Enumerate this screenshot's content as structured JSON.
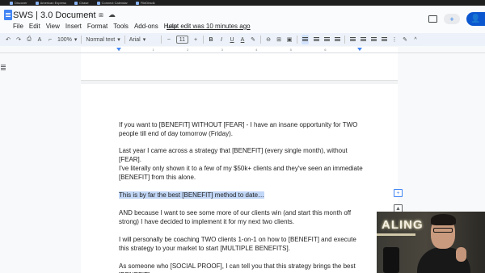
{
  "bookmarks": [
    {
      "label": "Discover"
    },
    {
      "label": "American Express"
    },
    {
      "label": "Chase"
    },
    {
      "label": "Connect Calendar"
    },
    {
      "label": "FileDirsdk"
    }
  ],
  "header": {
    "title": "SWS | 3.0 Document",
    "star_icon": "☆",
    "folder_icon": "⧈",
    "cloud_icon": "☁",
    "menu": [
      "File",
      "Edit",
      "View",
      "Insert",
      "Format",
      "Tools",
      "Add-ons",
      "Help"
    ],
    "last_edit": "Last edit was 10 minutes ago",
    "meet_icon": "+",
    "share_icon": "👤"
  },
  "toolbar": {
    "undo": "↶",
    "redo": "↷",
    "print": "⎙",
    "spell": "A",
    "paint": "⌐",
    "zoom": "100%",
    "style": "Normal text",
    "font": "Arial",
    "minus": "−",
    "size": "11",
    "plus": "+",
    "bold": "B",
    "italic": "I",
    "underline": "U",
    "text_color": "A",
    "highlight": "✎",
    "link": "⊖",
    "comment": "⊞",
    "image": "▣",
    "dropdown_arrow": "▾",
    "more": "⋮",
    "edit_pencil": "✎",
    "collapse": "^"
  },
  "ruler": {
    "numbers": [
      "1",
      "1",
      "2",
      "3",
      "4",
      "5",
      "6",
      "7"
    ]
  },
  "document": {
    "paragraphs": [
      "If you want to [BENEFIT] WITHOUT [FEAR] - I have an insane opportunity for TWO people till end of day tomorrow (Friday).",
      "Last year I came across a strategy that [BENEFIT] (every single month), without [FEAR].",
      "I've literally only shown it to a few of my $50k+ clients and they've seen an immediate [BENEFIT] from this alone.",
      "This is by far the best [BENEFIT] method to date…",
      "AND because I want to see some more of our clients win (and start this month off strong) I have decided to implement it for my next two clients.",
      "I will personally be coaching TWO clients 1-on-1 on how to [BENEFIT] and execute this strategy to your market to start [MULTIPLE BENEFITS].",
      "As someone who [SOCIAL PROOF], I can tell you that this strategy brings the best [BENEFIT]."
    ]
  },
  "side_buttons": {
    "add_comment": "+",
    "add_image": "▲"
  },
  "webcam": {
    "sign_text": "ALING"
  },
  "colors": {
    "accent": "#0b57d0",
    "highlight": "#c2d7f7",
    "toolbar_bg": "#edf2fa"
  }
}
